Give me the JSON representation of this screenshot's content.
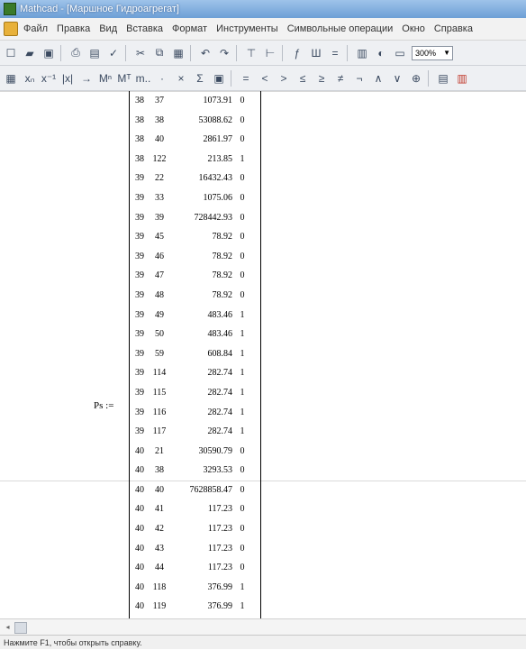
{
  "window": {
    "title": "Mathcad - [Маршное Гидроагрегат]"
  },
  "menu": [
    "Файл",
    "Правка",
    "Вид",
    "Вставка",
    "Формат",
    "Инструменты",
    "Символьные операции",
    "Окно",
    "Справка"
  ],
  "toolbar": {
    "zoom": "300%"
  },
  "worksheet": {
    "var_label": "Ps :=",
    "rows": [
      [
        "38",
        "37",
        "1073.91",
        "0"
      ],
      [
        "38",
        "38",
        "53088.62",
        "0"
      ],
      [
        "38",
        "40",
        "2861.97",
        "0"
      ],
      [
        "38",
        "122",
        "213.85",
        "1"
      ],
      [
        "39",
        "22",
        "16432.43",
        "0"
      ],
      [
        "39",
        "33",
        "1075.06",
        "0"
      ],
      [
        "39",
        "39",
        "728442.93",
        "0"
      ],
      [
        "39",
        "45",
        "78.92",
        "0"
      ],
      [
        "39",
        "46",
        "78.92",
        "0"
      ],
      [
        "39",
        "47",
        "78.92",
        "0"
      ],
      [
        "39",
        "48",
        "78.92",
        "0"
      ],
      [
        "39",
        "49",
        "483.46",
        "1"
      ],
      [
        "39",
        "50",
        "483.46",
        "1"
      ],
      [
        "39",
        "59",
        "608.84",
        "1"
      ],
      [
        "39",
        "114",
        "282.74",
        "1"
      ],
      [
        "39",
        "115",
        "282.74",
        "1"
      ],
      [
        "39",
        "116",
        "282.74",
        "1"
      ],
      [
        "39",
        "117",
        "282.74",
        "1"
      ],
      [
        "40",
        "21",
        "30590.79",
        "0"
      ],
      [
        "40",
        "38",
        "3293.53",
        "0"
      ],
      [
        "40",
        "40",
        "7628858.47",
        "0"
      ],
      [
        "40",
        "41",
        "117.23",
        "0"
      ],
      [
        "40",
        "42",
        "117.23",
        "0"
      ],
      [
        "40",
        "43",
        "117.23",
        "0"
      ],
      [
        "40",
        "44",
        "117.23",
        "0"
      ],
      [
        "40",
        "118",
        "376.99",
        "1"
      ],
      [
        "40",
        "119",
        "376.99",
        "1"
      ]
    ]
  },
  "status": {
    "text": "Нажмите F1, чтобы открыть справку."
  }
}
